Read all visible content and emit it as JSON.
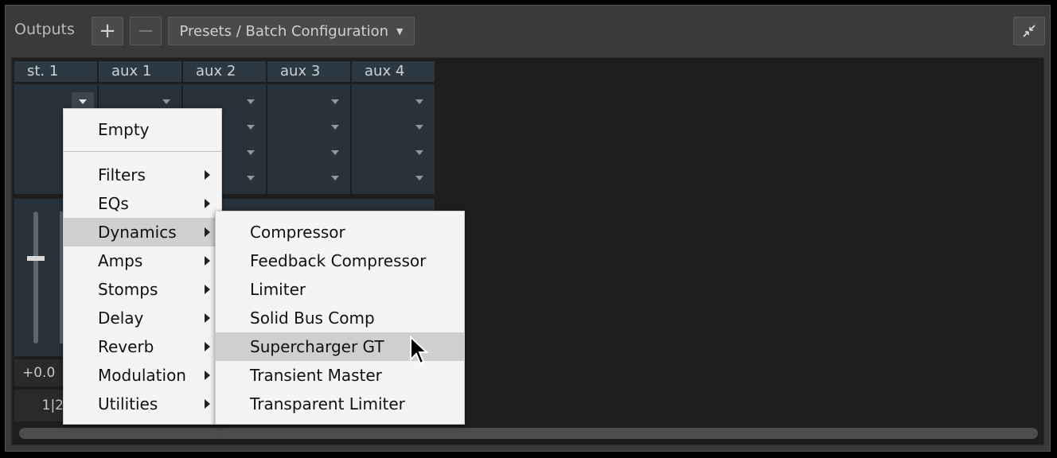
{
  "header": {
    "title": "Outputs",
    "add_label": "+",
    "remove_label": "−",
    "presets_label": "Presets / Batch Configuration"
  },
  "channels": [
    {
      "label": "st. 1"
    },
    {
      "label": "aux 1"
    },
    {
      "label": "aux 2"
    },
    {
      "label": "aux 3"
    },
    {
      "label": "aux 4"
    }
  ],
  "strip": {
    "volume": "+0.0",
    "routing": "1|2"
  },
  "menu": {
    "empty": "Empty",
    "categories": [
      "Filters",
      "EQs",
      "Dynamics",
      "Amps",
      "Stomps",
      "Delay",
      "Reverb",
      "Modulation",
      "Utilities"
    ]
  },
  "submenu": {
    "items": [
      "Compressor",
      "Feedback Compressor",
      "Limiter",
      "Solid Bus Comp",
      "Supercharger GT",
      "Transient Master",
      "Transparent Limiter"
    ]
  },
  "colors": {
    "highlight": "#cfcfcf",
    "channel_tab": "#2d3942"
  }
}
